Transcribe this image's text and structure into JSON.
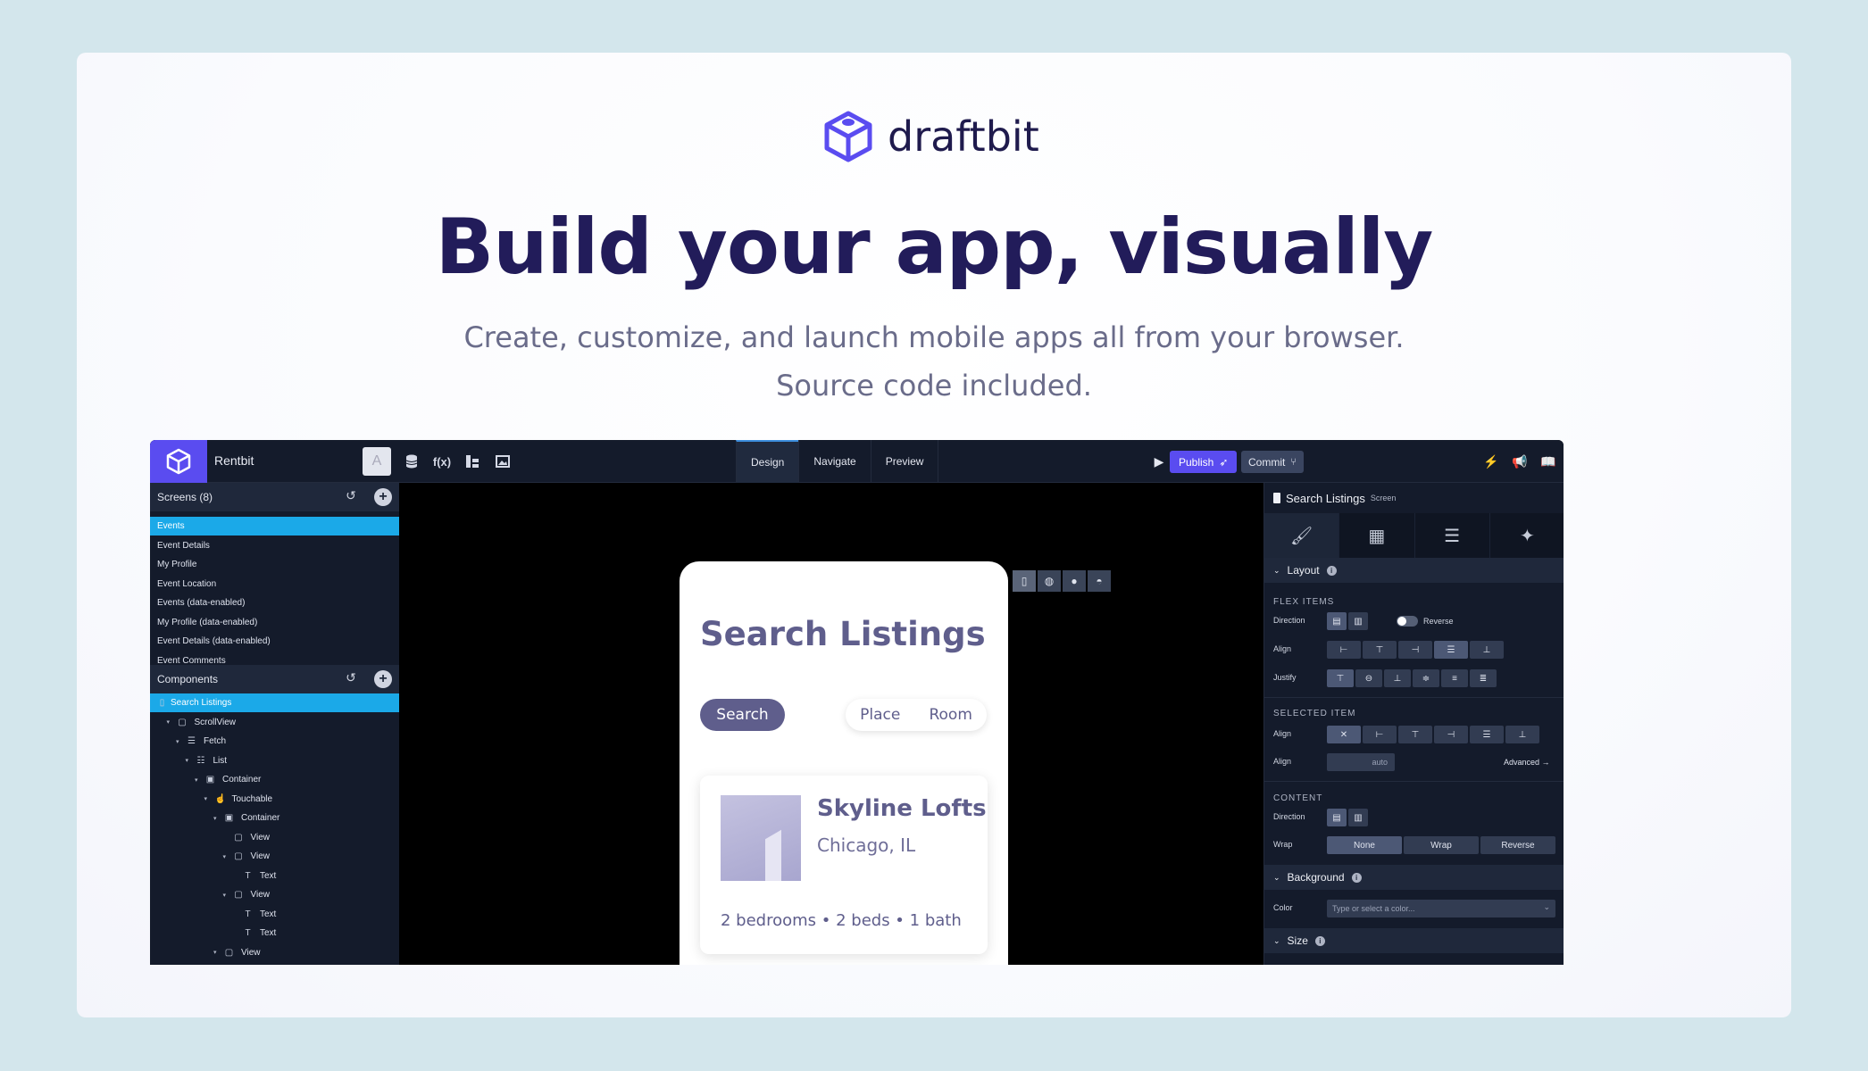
{
  "hero": {
    "brand": "draftbit",
    "headline": "Build your app, visually",
    "sub_line1": "Create, customize, and launch mobile apps all from your browser.",
    "sub_line2": "Source code included."
  },
  "topbar": {
    "project": "Rentbit",
    "avatar_letter": "A",
    "tools": [
      "database-icon",
      "function-icon",
      "theme-icon",
      "media-icon"
    ],
    "function_label": "f(x)",
    "modes": [
      "Design",
      "Navigate",
      "Preview"
    ],
    "active_mode": "Design",
    "publish_label": "Publish",
    "commit_label": "Commit"
  },
  "screens": {
    "header": "Screens (8)",
    "items": [
      "Events",
      "Event Details",
      "My Profile",
      "Event Location",
      "Events (data-enabled)",
      "My Profile (data-enabled)",
      "Event Details (data-enabled)",
      "Event Comments"
    ],
    "selected": "Events"
  },
  "components": {
    "header": "Components",
    "tree": [
      {
        "label": "Search Listings",
        "depth": 0
      },
      {
        "label": "ScrollView",
        "depth": 1
      },
      {
        "label": "Fetch",
        "depth": 2
      },
      {
        "label": "List",
        "depth": 3
      },
      {
        "label": "Container",
        "depth": 4
      },
      {
        "label": "Touchable",
        "depth": 5
      },
      {
        "label": "Container",
        "depth": 6
      },
      {
        "label": "View",
        "depth": 7
      },
      {
        "label": "View",
        "depth": 7
      },
      {
        "label": "Text",
        "depth": 8
      },
      {
        "label": "View",
        "depth": 7
      },
      {
        "label": "Text",
        "depth": 8
      },
      {
        "label": "Text",
        "depth": 8
      },
      {
        "label": "View",
        "depth": 6
      }
    ]
  },
  "phone": {
    "title": "Search Listings",
    "search_pill": "Search",
    "segments": [
      "Place",
      "Room"
    ],
    "listing": {
      "title": "Skyline Lofts",
      "location": "Chicago, IL",
      "meta": "2 bedrooms • 2 beds • 1 bath"
    }
  },
  "inspector": {
    "title": "Search Listings",
    "subtitle": "Screen",
    "layout_band": "Layout",
    "flex_items_cap": "FLEX ITEMS",
    "direction_label": "Direction",
    "reverse_label": "Reverse",
    "align_label": "Align",
    "justify_label": "Justify",
    "selected_item_cap": "SELECTED ITEM",
    "align_value": "auto",
    "advanced_link": "Advanced →",
    "content_cap": "CONTENT",
    "wrap_label": "Wrap",
    "wrap_options": [
      "None",
      "Wrap",
      "Reverse"
    ],
    "background_band": "Background",
    "color_label": "Color",
    "color_placeholder": "Type or select a color...",
    "size_band": "Size"
  },
  "colors": {
    "accent": "#5a4cf0",
    "selected_row": "#1ba9e8",
    "headline": "#221c5a",
    "phone_text": "#5f5e8c"
  }
}
